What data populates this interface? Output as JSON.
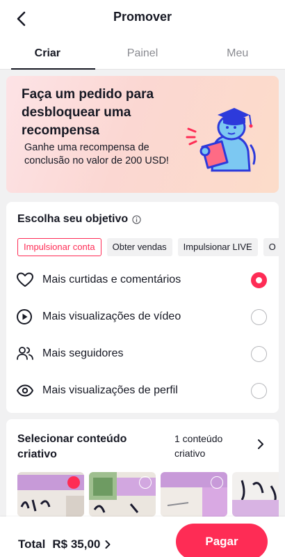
{
  "header": {
    "title": "Promover",
    "back_icon": "chevron-left-icon"
  },
  "tabs": [
    {
      "label": "Criar",
      "active": true
    },
    {
      "label": "Painel",
      "active": false
    },
    {
      "label": "Meu",
      "active": false
    }
  ],
  "promo": {
    "title": "Faça um pedido para desbloquear uma recompensa",
    "subtitle": "Ganhe uma recompensa de conclusão no valor de 200 USD!",
    "illustration": "student-with-graduation-cap-illustration"
  },
  "objective": {
    "title": "Escolha seu objetivo",
    "info_icon": "info-icon",
    "chips": [
      {
        "label": "Impulsionar conta",
        "active": true
      },
      {
        "label": "Obter vendas",
        "active": false
      },
      {
        "label": "Impulsionar LIVE",
        "active": false
      },
      {
        "label": "O",
        "active": false
      }
    ],
    "options": [
      {
        "label": "Mais curtidas e comentários",
        "icon": "heart-icon",
        "selected": true
      },
      {
        "label": "Mais visualizações de vídeo",
        "icon": "play-circle-icon",
        "selected": false
      },
      {
        "label": "Mais seguidores",
        "icon": "users-icon",
        "selected": false
      },
      {
        "label": "Mais visualizações de perfil",
        "icon": "eye-icon",
        "selected": false
      }
    ]
  },
  "content": {
    "title": "Selecionar conteúdo criativo",
    "count_label": "1 conteúdo criativo",
    "chevron_icon": "chevron-right-icon",
    "thumbnails": [
      {
        "selected": true
      },
      {
        "selected": false
      },
      {
        "selected": false
      },
      {
        "selected": false
      }
    ]
  },
  "footer": {
    "total_label": "Total",
    "total_value": "R$ 35,00",
    "pay_label": "Pagar"
  },
  "colors": {
    "accent": "#fe2c55",
    "text": "#161823",
    "muted": "#8a8b91",
    "background": "#f1f1f2"
  }
}
